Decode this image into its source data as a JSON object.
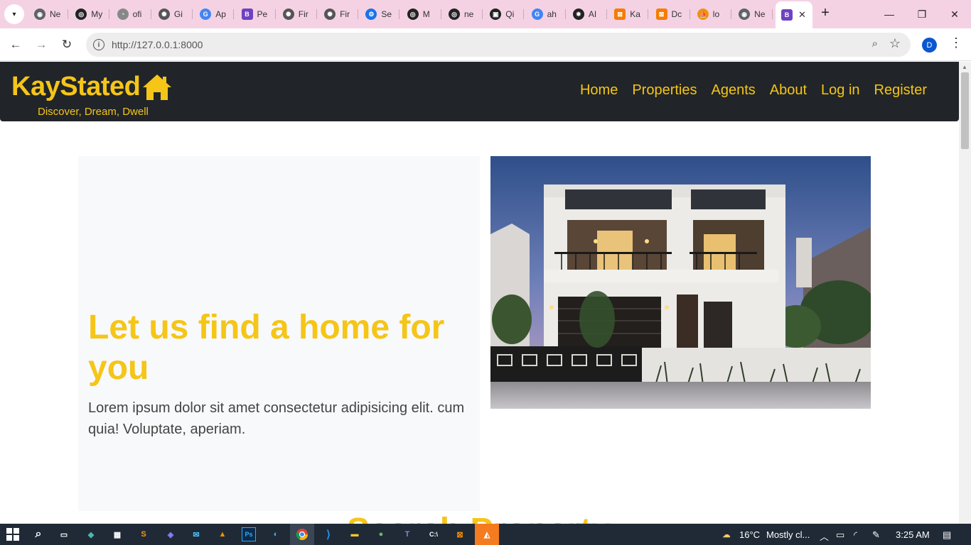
{
  "browser": {
    "tabs": [
      {
        "label": "Ne",
        "icon": "chrome-icon",
        "color": "#5f6368"
      },
      {
        "label": "My",
        "icon": "circle-logo-icon",
        "color": "#222222"
      },
      {
        "label": "ofi",
        "icon": "github-icon",
        "color": "#888888"
      },
      {
        "label": "Gi",
        "icon": "openai-icon",
        "color": "#555555"
      },
      {
        "label": "Ap",
        "icon": "google-icon",
        "color": "#4285f4"
      },
      {
        "label": "Pe",
        "icon": "bootstrap-icon",
        "color": "#6f42c1"
      },
      {
        "label": "Fir",
        "icon": "openai-icon",
        "color": "#555555"
      },
      {
        "label": "Fir",
        "icon": "openai-icon",
        "color": "#555555"
      },
      {
        "label": "Se",
        "icon": "gear-icon",
        "color": "#1a73e8"
      },
      {
        "label": "M",
        "icon": "circle-logo-icon",
        "color": "#222222"
      },
      {
        "label": "ne",
        "icon": "circle-logo-icon",
        "color": "#222222"
      },
      {
        "label": "Qi",
        "icon": "square-logo-icon",
        "color": "#222222"
      },
      {
        "label": "ah",
        "icon": "google-icon",
        "color": "#4285f4"
      },
      {
        "label": "AI",
        "icon": "aperture-icon",
        "color": "#222222"
      },
      {
        "label": "Ka",
        "icon": "xampp-icon",
        "color": "#f57c00"
      },
      {
        "label": "Dc",
        "icon": "xampp-icon",
        "color": "#f57c00"
      },
      {
        "label": "lo",
        "icon": "phpmyadmin-icon",
        "color": "#f29111"
      },
      {
        "label": "Ne",
        "icon": "chrome-icon",
        "color": "#5f6368"
      }
    ],
    "active_tab": {
      "icon": "bootstrap-icon",
      "color": "#6f42c1"
    },
    "url": "http://127.0.0.1:8000",
    "profile_initial": "D"
  },
  "site": {
    "brand": "KayStated",
    "tagline": "Discover, Dream, Dwell",
    "nav": [
      "Home",
      "Properties",
      "Agents",
      "About",
      "Log in",
      "Register"
    ],
    "hero_title": "Let us find a home for you",
    "hero_text": "Lorem ipsum dolor sit amet consectetur adipisicing elit. cum quia! Voluptate, aperiam.",
    "search_heading": "Search Property",
    "accent_color": "#f5c518",
    "nav_bg": "#212529"
  },
  "taskbar": {
    "weather": "16°C",
    "weather_desc": "Mostly cl...",
    "time": "3:25 AM"
  }
}
